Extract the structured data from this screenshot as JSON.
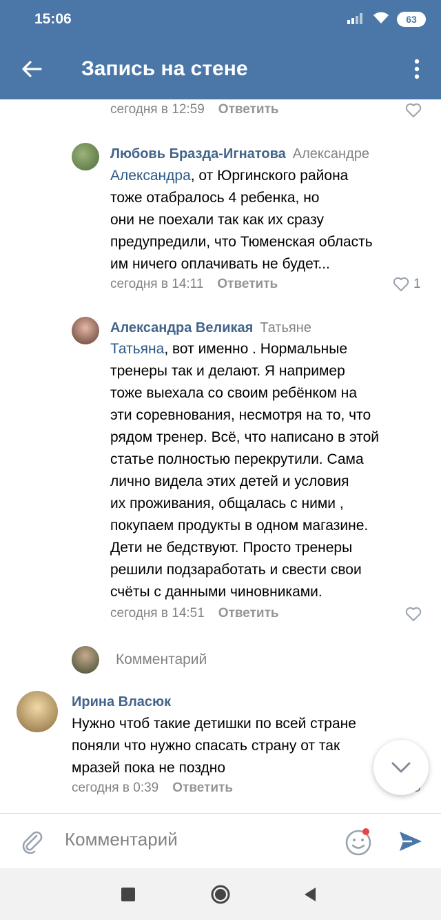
{
  "status_bar": {
    "time": "15:06",
    "battery": "63"
  },
  "app_bar": {
    "title": "Запись на стене",
    "back_icon": "arrow-back-icon",
    "menu_icon": "more-vert-icon"
  },
  "comments": [
    {
      "time": "сегодня в 12:59",
      "reply_label": "Ответить",
      "likes": ""
    },
    {
      "author": "Любовь Бразда-Игнатова",
      "addressee": "Александре",
      "mention": "Александра",
      "text_lines": [
        ", от Юргинского района",
        "тоже отабралось 4 ребенка, но",
        "они не поехали так как их сразу",
        "предупредили, что Тюменская область",
        "им ничего оплачивать не будет..."
      ],
      "time": "сегодня в 14:11",
      "reply_label": "Ответить",
      "likes": "1"
    },
    {
      "author": "Александра Великая",
      "addressee": "Татьяне",
      "mention": "Татьяна",
      "text_lines": [
        ", вот именно . Нормальные",
        "тренеры так и делают. Я например",
        "тоже выехала со своим ребёнком на",
        "эти соревнования, несмотря на то, что",
        "рядом тренер. Всё, что написано в этой",
        "статье полностью перекрутили. Сама",
        "лично видела этих детей и условия",
        "их проживания, общалась с ними ,",
        "покупаем продукты в одном магазине.",
        "Дети не бедствуют. Просто тренеры",
        "решили подзаработать и свести свои",
        "счёты с данными чиновниками."
      ],
      "time": "сегодня в 14:51",
      "reply_label": "Ответить",
      "likes": ""
    },
    {
      "author": "Ирина Власюк",
      "text_lines": [
        "Нужно чтоб такие детишки по всей стране",
        "поняли что нужно спасать страну от так",
        "мразей пока не поздно"
      ],
      "time": "сегодня в 0:39",
      "reply_label": "Ответить",
      "likes": "5"
    }
  ],
  "reply_input": {
    "placeholder": "Комментарий"
  },
  "composer": {
    "placeholder": "Комментарий"
  },
  "colors": {
    "accent": "#4a76a8",
    "link": "#2a5885",
    "author": "#42648b",
    "meta": "#828282"
  }
}
